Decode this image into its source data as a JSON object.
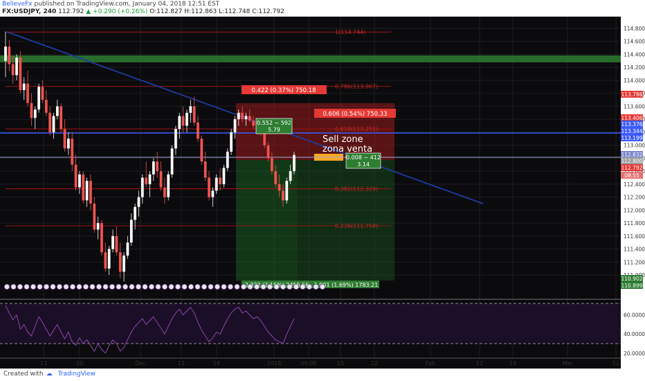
{
  "header": {
    "author": "BelieveFx",
    "published_text": "published on TradingView.com, January 04, 2018 12:51 EST",
    "symbol": "FX:USDJPY, 240",
    "last": "112.792",
    "change": "+0.290 (+0.26%)",
    "ohlc": "O:112.827 H:112.863 L:112.748 C:112.792"
  },
  "chart_data": {
    "type": "candlestick",
    "symbol": "FX:USDJPY",
    "interval": "240",
    "ylim": [
      110.8,
      114.9
    ],
    "price_ticks": [
      "114.800",
      "114.600",
      "114.400",
      "114.200",
      "114.000",
      "113.800",
      "113.600",
      "113.400",
      "113.200",
      "113.000",
      "112.800",
      "112.600",
      "112.400",
      "112.200",
      "112.000",
      "111.800",
      "111.600",
      "111.400",
      "111.200",
      "111.000"
    ],
    "time_ticks": [
      "13",
      "20",
      "Dec",
      "11",
      "18",
      "2018",
      "09:00",
      "15",
      "22",
      "Feb",
      "12",
      "19",
      "Mar",
      "12"
    ],
    "price_labels": [
      {
        "value": "113.786",
        "color": "#e53935"
      },
      {
        "value": "113.406",
        "color": "#e53935"
      },
      {
        "value": "113.376",
        "color": "#3d5afe"
      },
      {
        "value": "113.344",
        "color": "#3d5afe"
      },
      {
        "value": "113.199",
        "color": "#3d5afe"
      },
      {
        "value": "112.832",
        "color": "#7986cb"
      },
      {
        "value": "112.800",
        "color": "#9e9e9e"
      },
      {
        "value": "112.792",
        "color": "#e53935"
      },
      {
        "value": "08:55",
        "color": "#e57373"
      },
      {
        "value": "110.902",
        "color": "#2e7d32"
      },
      {
        "value": "110.899",
        "color": "#2e7d32"
      }
    ],
    "fib_levels": [
      {
        "label": "1(114.744)",
        "price": 114.744
      },
      {
        "label": "0.786(113.907)",
        "price": 113.907
      },
      {
        "label": "0.618(113.251)",
        "price": 113.251
      },
      {
        "label": "0.382(112.329)",
        "price": 112.329
      },
      {
        "label": "0.236(111.758)",
        "price": 111.758
      }
    ],
    "annotations": {
      "sell_zone": "Sell zone",
      "zona_venta": "zona venta",
      "box_red_1": "0.422 (0.37%) 750.18",
      "box_red_2": "0.606 (0.54%) 750.33",
      "box_green_top_1": "0.552 ~ 592",
      "box_green_top_2": "5.79",
      "box_green_mid_1": "0.008 ~ 412",
      "box_green_mid_2": "3.14",
      "box_green_bottom": "2.332 (2.15%) 2455.56",
      "box_green_bottom_2": "1.901 (1.69%) 1783.21"
    },
    "rsi_ticks": [
      "60.0000",
      "40.0000",
      "20.0000"
    ],
    "close": 112.792,
    "candles": [
      [
        114.3,
        114.75,
        114.05,
        114.52
      ],
      [
        114.52,
        114.62,
        114.15,
        114.25
      ],
      [
        114.25,
        114.38,
        113.95,
        114.08
      ],
      [
        114.08,
        114.4,
        114.0,
        114.35
      ],
      [
        114.35,
        114.45,
        113.8,
        113.85
      ],
      [
        113.85,
        114.05,
        113.7,
        113.95
      ],
      [
        113.95,
        114.15,
        113.6,
        113.65
      ],
      [
        113.65,
        113.8,
        113.3,
        113.42
      ],
      [
        113.42,
        113.6,
        113.25,
        113.55
      ],
      [
        113.55,
        113.95,
        113.5,
        113.9
      ],
      [
        113.9,
        114.0,
        113.65,
        113.7
      ],
      [
        113.7,
        113.85,
        113.45,
        113.5
      ],
      [
        113.5,
        113.6,
        113.15,
        113.2
      ],
      [
        113.2,
        113.5,
        113.1,
        113.45
      ],
      [
        113.45,
        113.7,
        113.4,
        113.6
      ],
      [
        113.6,
        113.65,
        113.2,
        113.25
      ],
      [
        113.25,
        113.4,
        112.9,
        112.95
      ],
      [
        112.95,
        113.2,
        112.85,
        113.1
      ],
      [
        113.1,
        113.2,
        112.6,
        112.7
      ],
      [
        112.7,
        112.85,
        112.3,
        112.35
      ],
      [
        112.35,
        112.6,
        112.25,
        112.55
      ],
      [
        112.55,
        112.6,
        112.1,
        112.15
      ],
      [
        112.15,
        112.5,
        112.05,
        112.45
      ],
      [
        112.45,
        112.55,
        112.0,
        112.1
      ],
      [
        112.1,
        112.2,
        111.65,
        111.7
      ],
      [
        111.7,
        111.9,
        111.55,
        111.8
      ],
      [
        111.8,
        111.85,
        111.3,
        111.35
      ],
      [
        111.35,
        111.5,
        111.05,
        111.1
      ],
      [
        111.1,
        111.45,
        111.0,
        111.4
      ],
      [
        111.4,
        111.7,
        111.35,
        111.6
      ],
      [
        111.6,
        111.75,
        111.3,
        111.35
      ],
      [
        111.35,
        111.5,
        110.95,
        111.05
      ],
      [
        111.05,
        111.35,
        110.9,
        111.3
      ],
      [
        111.3,
        111.6,
        111.25,
        111.5
      ],
      [
        111.5,
        111.95,
        111.45,
        111.85
      ],
      [
        111.85,
        112.1,
        111.7,
        112.05
      ],
      [
        112.05,
        112.3,
        111.9,
        112.2
      ],
      [
        112.2,
        112.55,
        112.1,
        112.5
      ],
      [
        112.5,
        112.75,
        112.35,
        112.4
      ],
      [
        112.4,
        112.6,
        112.2,
        112.55
      ],
      [
        112.55,
        112.8,
        112.45,
        112.75
      ],
      [
        112.75,
        112.9,
        112.5,
        112.6
      ],
      [
        112.6,
        112.75,
        112.3,
        112.35
      ],
      [
        112.35,
        112.5,
        112.1,
        112.2
      ],
      [
        112.2,
        112.6,
        112.15,
        112.55
      ],
      [
        112.55,
        113.0,
        112.5,
        112.95
      ],
      [
        112.95,
        113.3,
        112.85,
        113.25
      ],
      [
        113.25,
        113.5,
        113.1,
        113.45
      ],
      [
        113.45,
        113.6,
        113.2,
        113.3
      ],
      [
        113.3,
        113.55,
        113.2,
        113.5
      ],
      [
        113.5,
        113.7,
        113.35,
        113.6
      ],
      [
        113.6,
        113.75,
        113.3,
        113.35
      ],
      [
        113.35,
        113.45,
        113.05,
        113.1
      ],
      [
        113.1,
        113.15,
        112.7,
        112.75
      ],
      [
        112.75,
        112.9,
        112.45,
        112.5
      ],
      [
        112.5,
        112.6,
        112.15,
        112.2
      ],
      [
        112.2,
        112.35,
        112.05,
        112.3
      ],
      [
        112.3,
        112.55,
        112.25,
        112.5
      ],
      [
        112.5,
        112.65,
        112.3,
        112.4
      ],
      [
        112.4,
        112.7,
        112.35,
        112.65
      ],
      [
        112.65,
        112.95,
        112.6,
        112.9
      ],
      [
        112.9,
        113.25,
        112.85,
        113.2
      ],
      [
        113.2,
        113.45,
        113.1,
        113.4
      ],
      [
        113.4,
        113.55,
        113.3,
        113.5
      ],
      [
        113.5,
        113.6,
        113.35,
        113.4
      ],
      [
        113.4,
        113.5,
        113.3,
        113.45
      ],
      [
        113.45,
        113.55,
        113.35,
        113.38
      ],
      [
        113.38,
        113.45,
        113.25,
        113.3
      ],
      [
        113.3,
        113.4,
        113.2,
        113.35
      ],
      [
        113.35,
        113.4,
        113.15,
        113.2
      ],
      [
        113.2,
        113.25,
        112.95,
        113.0
      ],
      [
        113.0,
        113.05,
        112.75,
        112.8
      ],
      [
        112.8,
        112.9,
        112.55,
        112.6
      ],
      [
        112.6,
        112.7,
        112.35,
        112.4
      ],
      [
        112.4,
        112.55,
        112.2,
        112.3
      ],
      [
        112.3,
        112.4,
        112.05,
        112.15
      ],
      [
        112.15,
        112.5,
        112.1,
        112.45
      ],
      [
        112.45,
        112.7,
        112.4,
        112.6
      ],
      [
        112.6,
        112.9,
        112.55,
        112.85
      ]
    ],
    "rsi": [
      70,
      62,
      55,
      60,
      45,
      50,
      42,
      38,
      48,
      58,
      52,
      45,
      38,
      44,
      50,
      42,
      35,
      42,
      32,
      28,
      36,
      30,
      34,
      28,
      22,
      30,
      24,
      20,
      28,
      34,
      30,
      22,
      26,
      34,
      42,
      48,
      52,
      56,
      50,
      54,
      58,
      52,
      46,
      40,
      48,
      56,
      62,
      66,
      60,
      64,
      68,
      62,
      52,
      44,
      38,
      32,
      36,
      42,
      40,
      48,
      56,
      62,
      66,
      68,
      62,
      64,
      60,
      56,
      58,
      54,
      48,
      42,
      38,
      34,
      32,
      30,
      40,
      48,
      56
    ]
  },
  "footer": {
    "created_with": "Created with",
    "brand": "TradingView"
  }
}
